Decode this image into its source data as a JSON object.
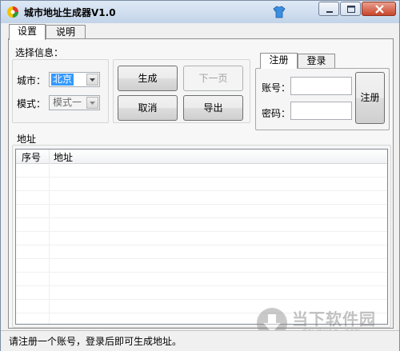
{
  "window": {
    "title": "城市地址生成器V1.0"
  },
  "tabs": [
    {
      "label": "设置"
    },
    {
      "label": "说明"
    }
  ],
  "select_info": {
    "label": "选择信息：",
    "city_label": "城市：",
    "city_value": "北京",
    "mode_label": "模式：",
    "mode_value": "模式一"
  },
  "actions": {
    "generate": "生成",
    "next_page": "下一页",
    "cancel": "取消",
    "export": "导出"
  },
  "account": {
    "tabs": [
      {
        "label": "注册"
      },
      {
        "label": "登录"
      }
    ],
    "username_label": "账号：",
    "password_label": "密码：",
    "username_value": "",
    "password_value": "",
    "register_button": "注册"
  },
  "address": {
    "label": "地址",
    "columns": [
      {
        "label": "序号"
      },
      {
        "label": "地址"
      }
    ],
    "rows": []
  },
  "status": {
    "text": "请注册一个账号，登录后即可生成地址。"
  },
  "watermark": {
    "text": "当下软件园",
    "sub": "downxia.com"
  },
  "colors": {
    "selection": "#3399ff",
    "close_button": "#c9442a"
  }
}
